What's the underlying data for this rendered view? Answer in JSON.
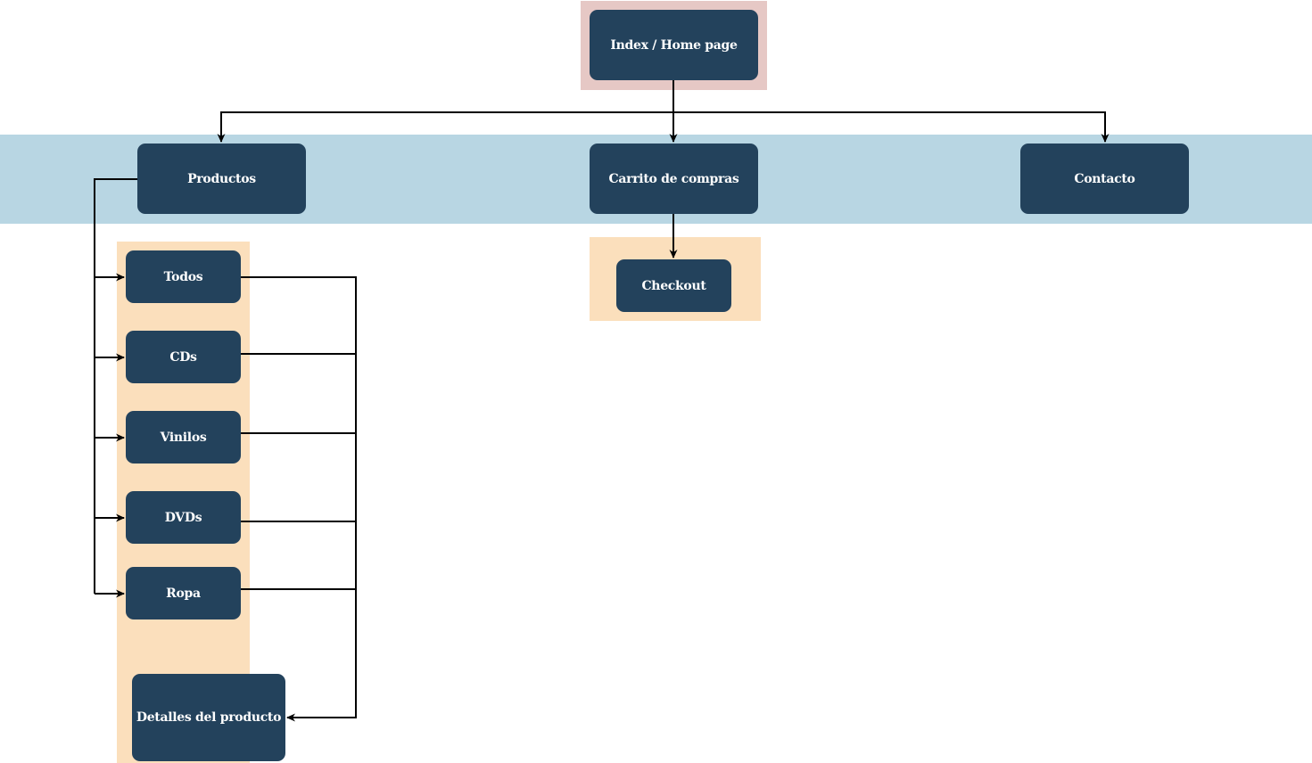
{
  "colors": {
    "node_fill": "#23425c",
    "node_text": "#ffffff",
    "home_band": "#e6c8c5",
    "main_band": "#b8d6e3",
    "sub_band": "#fbdfbc",
    "connector": "#000000"
  },
  "nodes": {
    "home": "Index / Home page",
    "productos": "Productos",
    "carrito": "Carrito de compras",
    "contacto": "Contacto",
    "checkout": "Checkout",
    "todos": "Todos",
    "cds": "CDs",
    "vinilos": "Vinilos",
    "dvds": "DVDs",
    "ropa": "Ropa",
    "detalles": "Detalles del producto"
  }
}
